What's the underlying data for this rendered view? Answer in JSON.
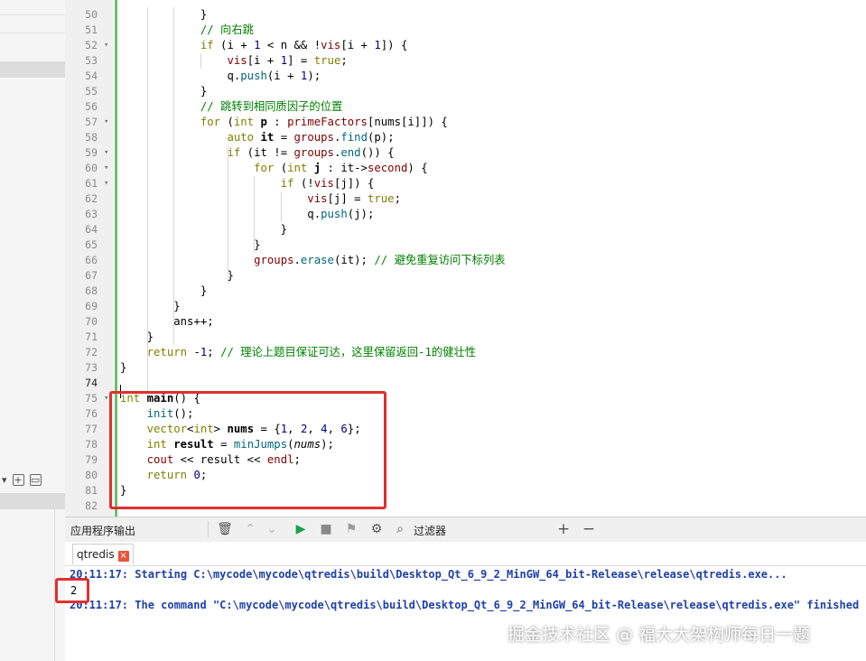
{
  "editor": {
    "lines": [
      {
        "n": "50",
        "fold": "",
        "html": "            }"
      },
      {
        "n": "51",
        "fold": "",
        "html": "            <span class=\"cm\">// 向右跳</span>"
      },
      {
        "n": "52",
        "fold": "▾",
        "html": "            <span class=\"kw\">if</span> (i + <span class=\"num\">1</span> &lt; n &amp;&amp; !<span class=\"var\">vis</span>[i + <span class=\"num\">1</span>]) {"
      },
      {
        "n": "53",
        "fold": "",
        "html": "                <span class=\"var\">vis</span>[i + <span class=\"num\">1</span>] = <span class=\"kw\">true</span>;"
      },
      {
        "n": "54",
        "fold": "",
        "html": "                q.<span class=\"fn\">push</span>(i + <span class=\"num\">1</span>);"
      },
      {
        "n": "55",
        "fold": "",
        "html": "            }"
      },
      {
        "n": "56",
        "fold": "",
        "html": "            <span class=\"cm\">// 跳转到相同质因子的位置</span>"
      },
      {
        "n": "57",
        "fold": "▾",
        "html": "            <span class=\"kw\">for</span> (<span class=\"ty\">int</span> <span class=\"b\">p</span> : <span class=\"var\">primeFactors</span>[nums[i]]) {"
      },
      {
        "n": "58",
        "fold": "",
        "html": "                <span class=\"kw\">auto</span> <span class=\"b\">it</span> = <span class=\"var\">groups</span>.<span class=\"fn\">find</span>(p);"
      },
      {
        "n": "59",
        "fold": "▾",
        "html": "                <span class=\"kw\">if</span> (it != <span class=\"var\">groups</span>.<span class=\"fn\">end</span>()) {"
      },
      {
        "n": "60",
        "fold": "▾",
        "html": "                    <span class=\"kw\">for</span> (<span class=\"ty\">int</span> <span class=\"b\">j</span> : it-&gt;<span class=\"var\">second</span>) {"
      },
      {
        "n": "61",
        "fold": "▾",
        "html": "                        <span class=\"kw\">if</span> (!<span class=\"var\">vis</span>[j]) {"
      },
      {
        "n": "62",
        "fold": "",
        "html": "                            <span class=\"var\">vis</span>[j] = <span class=\"kw\">true</span>;"
      },
      {
        "n": "63",
        "fold": "",
        "html": "                            q.<span class=\"fn\">push</span>(j);"
      },
      {
        "n": "64",
        "fold": "",
        "html": "                        }"
      },
      {
        "n": "65",
        "fold": "",
        "html": "                    }"
      },
      {
        "n": "66",
        "fold": "",
        "html": "                    <span class=\"var\">groups</span>.<span class=\"fn\">erase</span>(it); <span class=\"cm\">// 避免重复访问下标列表</span>"
      },
      {
        "n": "67",
        "fold": "",
        "html": "                }"
      },
      {
        "n": "68",
        "fold": "",
        "html": "            }"
      },
      {
        "n": "69",
        "fold": "",
        "html": "        }"
      },
      {
        "n": "70",
        "fold": "",
        "html": "        ans++;"
      },
      {
        "n": "71",
        "fold": "",
        "html": "    }"
      },
      {
        "n": "72",
        "fold": "",
        "html": "    <span class=\"kw\">return</span> -<span class=\"num\">1</span>; <span class=\"cm\">// 理论上题目保证可达，这里保留返回-1的健壮性</span>"
      },
      {
        "n": "73",
        "fold": "",
        "html": "}"
      },
      {
        "n": "74",
        "fold": "",
        "html": ""
      },
      {
        "n": "75",
        "fold": "▾",
        "html": "<span class=\"ty\">int</span> <span class=\"b\">main</span>() {"
      },
      {
        "n": "76",
        "fold": "",
        "html": "    <span class=\"fn\">init</span>();"
      },
      {
        "n": "77",
        "fold": "",
        "html": "    <span class=\"ty\">vector</span>&lt;<span class=\"ty\">int</span>&gt; <span class=\"b\">nums</span> = {<span class=\"num\">1</span>, <span class=\"num\">2</span>, <span class=\"num\">4</span>, <span class=\"num\">6</span>};"
      },
      {
        "n": "78",
        "fold": "",
        "html": "    <span class=\"ty\">int</span> <span class=\"b\">result</span> = <span class=\"fn\">minJumps</span>(<span class=\"it\">nums</span>);"
      },
      {
        "n": "79",
        "fold": "",
        "html": "    <span class=\"var\">cout</span> &lt;&lt; result &lt;&lt; <span class=\"var\">endl</span>;"
      },
      {
        "n": "80",
        "fold": "",
        "html": "    <span class=\"kw\">return</span> <span class=\"num\">0</span>;"
      },
      {
        "n": "81",
        "fold": "",
        "html": "}"
      },
      {
        "n": "82",
        "fold": "",
        "html": ""
      }
    ],
    "current_line": "74"
  },
  "output_pane": {
    "title": "应用程序输出",
    "filter_label": "过滤器",
    "tab_label": "qtredis",
    "lines": [
      "20:11:17: Starting C:\\mycode\\mycode\\qtredis\\build\\Desktop_Qt_6_9_2_MinGW_64_bit-Release\\release\\qtredis.exe...",
      "2",
      "20:11:17: The command \"C:\\mycode\\mycode\\qtredis\\build\\Desktop_Qt_6_9_2_MinGW_64_bit-Release\\release\\qtredis.exe\" finished"
    ]
  },
  "watermark": "掘金技术社区 @ 福大大架构师每日一题",
  "colors": {
    "highlight_box": "#e03030",
    "change_bar": "#6bc06b",
    "output_text": "#1f3faa"
  }
}
